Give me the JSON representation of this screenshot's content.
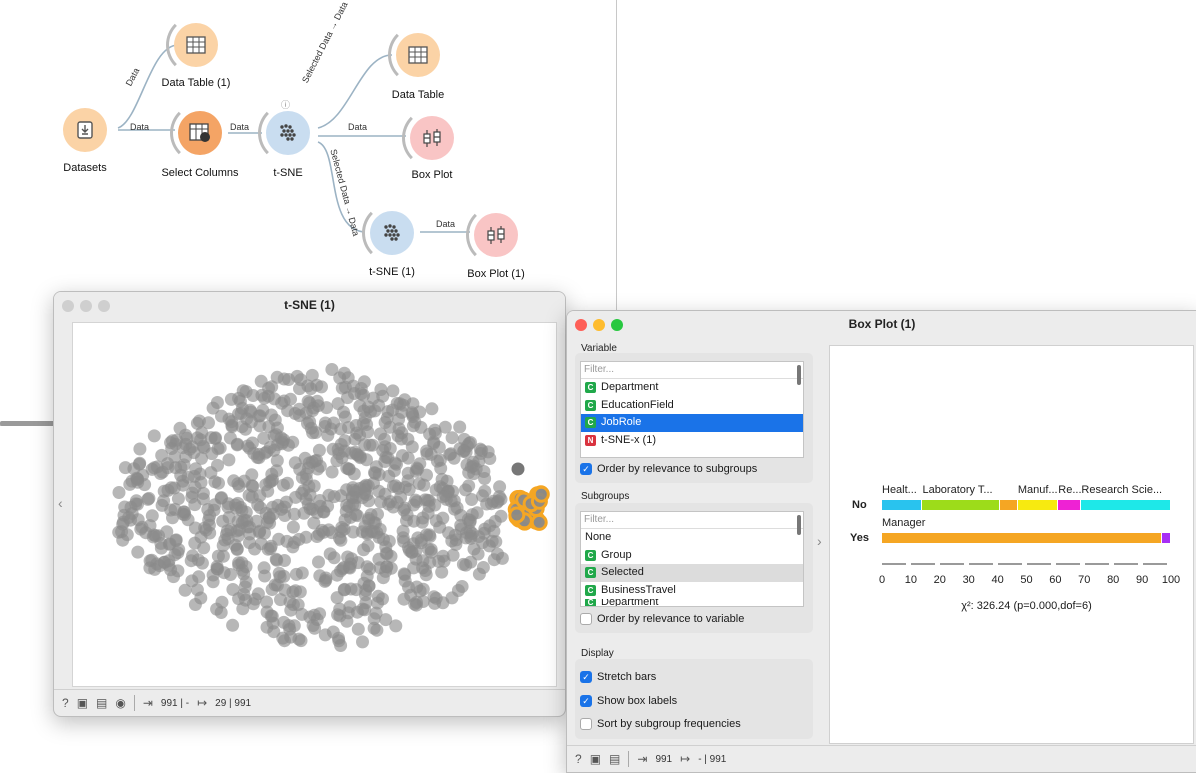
{
  "workflow": {
    "nodes": [
      {
        "label": "Datasets",
        "icon": "file-import-icon"
      },
      {
        "label": "Data Table (1)",
        "icon": "table-icon"
      },
      {
        "label": "Select Columns",
        "icon": "columns-icon"
      },
      {
        "label": "t-SNE",
        "icon": "scatter-dots-icon"
      },
      {
        "label": "Data Table",
        "icon": "table-icon"
      },
      {
        "label": "Box Plot",
        "icon": "box-plot-icon"
      },
      {
        "label": "t-SNE (1)",
        "icon": "scatter-dots-icon"
      },
      {
        "label": "Box Plot (1)",
        "icon": "box-plot-icon"
      }
    ],
    "link_labels": {
      "datasets_datatable": "Data",
      "datasets_select": "Data",
      "select_tsne": "Data",
      "tsne_datatable": "Selected Data → Data",
      "tsne_boxplot": "Data",
      "tsne_tsne1": "Selected Data → Data",
      "tsne1_boxplot1": "Data"
    }
  },
  "tsne_window": {
    "title": "t-SNE (1)",
    "status_in": "991 | -",
    "status_out": "29 | 991",
    "colors": {
      "point": "#8a8a8a",
      "selected": "#f5a623"
    }
  },
  "boxplot_window": {
    "title": "Box Plot (1)",
    "variable": {
      "title": "Variable",
      "filter_placeholder": "Filter...",
      "items": [
        {
          "type": "C",
          "label": "Department"
        },
        {
          "type": "C",
          "label": "EducationField"
        },
        {
          "type": "C",
          "label": "JobRole"
        },
        {
          "type": "N",
          "label": "t-SNE-x (1)"
        }
      ],
      "selected": "JobRole",
      "order_label": "Order by relevance to subgroups",
      "order_checked": true
    },
    "subgroups": {
      "title": "Subgroups",
      "filter_placeholder": "Filter...",
      "items": [
        {
          "type": "",
          "label": "None"
        },
        {
          "type": "C",
          "label": "Group"
        },
        {
          "type": "C",
          "label": "Selected"
        },
        {
          "type": "C",
          "label": "BusinessTravel"
        },
        {
          "type": "C",
          "label": "Department"
        }
      ],
      "highlighted": "Selected",
      "order_label": "Order by relevance to variable",
      "order_checked": false
    },
    "display": {
      "title": "Display",
      "stretch_label": "Stretch bars",
      "stretch_checked": true,
      "show_labels_label": "Show box labels",
      "show_labels_checked": true,
      "sort_label": "Sort by subgroup frequencies",
      "sort_checked": false
    },
    "status_in": "991",
    "status_out": "- | 991"
  },
  "chart_data": {
    "type": "bar",
    "orientation": "horizontal-stacked",
    "categories": [
      "No",
      "Yes"
    ],
    "xlim": [
      0,
      100
    ],
    "xticks": [
      "0",
      "10",
      "20",
      "30",
      "40",
      "50",
      "60",
      "70",
      "80",
      "90",
      "100"
    ],
    "stats": "χ²: 326.24 (p=0.000,dof=6)",
    "rows": [
      {
        "name": "No",
        "segments": [
          {
            "label": "Healt...",
            "value": 14,
            "color": "#29c3ee"
          },
          {
            "label": "Laboratory T...",
            "value": 27,
            "color": "#9ddc1a"
          },
          {
            "label": "",
            "value": 6,
            "color": "#f5a623"
          },
          {
            "label": "Manuf...",
            "value": 14,
            "color": "#f7ea10"
          },
          {
            "label": "Re...",
            "value": 8,
            "color": "#ee22d4"
          },
          {
            "label": "Research Scie...",
            "value": 31,
            "color": "#1ee8e8"
          }
        ]
      },
      {
        "name": "Yes",
        "segments": [
          {
            "label": "Manager",
            "value": 97,
            "color": "#f5a623"
          },
          {
            "label": "",
            "value": 3,
            "color": "#a72ff5"
          }
        ]
      }
    ]
  }
}
